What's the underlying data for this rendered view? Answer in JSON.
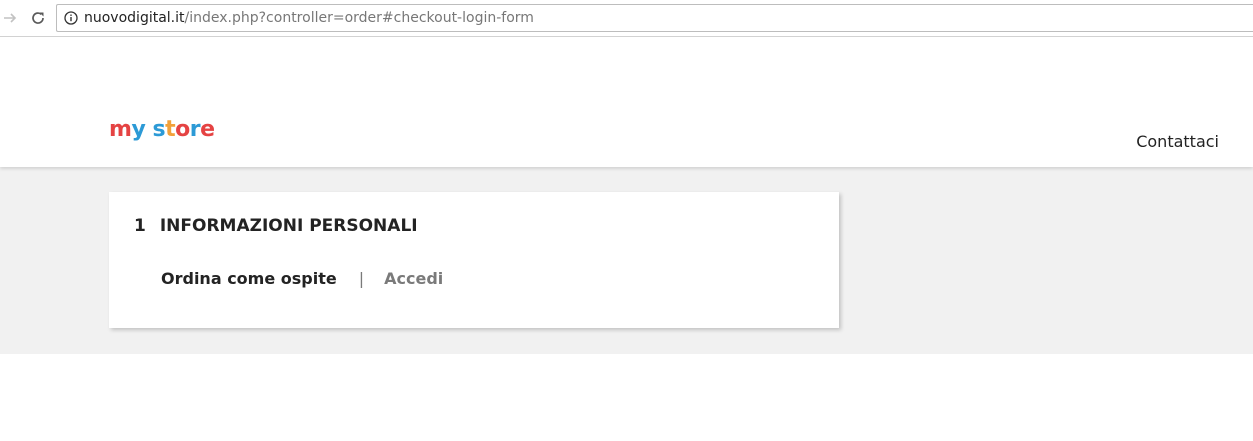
{
  "browser": {
    "url_host": "nuovodigital.it",
    "url_path": "/index.php?controller=order#checkout-login-form"
  },
  "header": {
    "logo_letters": [
      {
        "ch": "m",
        "color": "#e54343"
      },
      {
        "ch": "y",
        "color": "#2c9ad6"
      },
      {
        "ch": " ",
        "color": "#000000"
      },
      {
        "ch": "s",
        "color": "#2c9ad6"
      },
      {
        "ch": "t",
        "color": "#f2a13a"
      },
      {
        "ch": "o",
        "color": "#e54343"
      },
      {
        "ch": "r",
        "color": "#2c9ad6"
      },
      {
        "ch": "e",
        "color": "#e54343"
      }
    ],
    "contact_label": "Contattaci"
  },
  "checkout": {
    "step_number": "1",
    "step_title": "INFORMAZIONI PERSONALI",
    "tab_guest": "Ordina come ospite",
    "tab_separator": "|",
    "tab_login": "Accedi"
  },
  "colors": {
    "page_bg": "#f1f1f1",
    "text_dark": "#232323",
    "text_muted": "#7a7a7a"
  }
}
